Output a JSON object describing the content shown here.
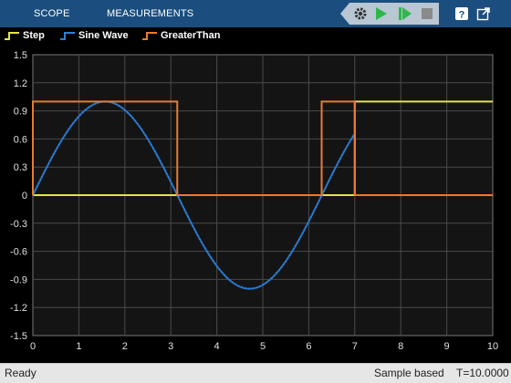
{
  "toolbar": {
    "tabs": [
      {
        "label": "SCOPE"
      },
      {
        "label": "MEASUREMENTS"
      }
    ],
    "icons": {
      "settings": "settings-gear-icon",
      "run": "run-play-icon",
      "step": "step-forward-icon",
      "stop": "stop-square-icon",
      "help": "help-question-icon",
      "undock": "undock-window-icon"
    },
    "accent_color": "#1b4e7e",
    "run_color": "#2db84b"
  },
  "status": {
    "ready": "Ready",
    "mode": "Sample based",
    "time": "T=10.0000"
  },
  "chart_data": {
    "type": "line",
    "title": "",
    "xlabel": "",
    "ylabel": "",
    "xlim": [
      0,
      10
    ],
    "ylim": [
      -1.5,
      1.5
    ],
    "grid": true,
    "legend_position": "top",
    "xticks": [
      0,
      1,
      2,
      3,
      4,
      5,
      6,
      7,
      8,
      9,
      10
    ],
    "yticks": [
      1.5,
      1.2,
      0.9,
      0.6,
      0.3,
      0,
      -0.3,
      -0.6,
      -0.9,
      -1.2,
      -1.5
    ],
    "series": [
      {
        "name": "Step",
        "color": "#e6e24a",
        "points": [
          [
            0,
            0
          ],
          [
            7,
            0
          ],
          [
            7,
            1
          ],
          [
            10,
            1
          ]
        ]
      },
      {
        "name": "Sine Wave",
        "color": "#2d7fd6",
        "function": "sin",
        "x_range": [
          0,
          7
        ]
      },
      {
        "name": "GreaterThan",
        "color": "#ea7a31",
        "points": [
          [
            0,
            0
          ],
          [
            0,
            1
          ],
          [
            3.14,
            1
          ],
          [
            3.14,
            0
          ],
          [
            6.28,
            0
          ],
          [
            6.28,
            1
          ],
          [
            7,
            1
          ],
          [
            7,
            0
          ],
          [
            10,
            0
          ]
        ]
      }
    ]
  }
}
